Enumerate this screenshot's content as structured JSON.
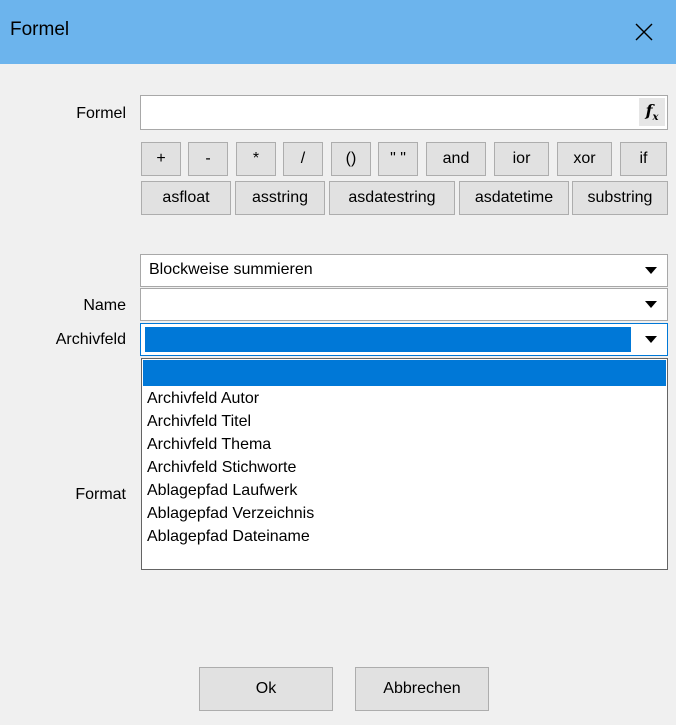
{
  "window": {
    "title": "Formel",
    "close_icon": "close-icon"
  },
  "formula": {
    "label": "Formel",
    "value": "",
    "fx_label": "fx"
  },
  "operators_row1": [
    "+",
    "-",
    "*",
    "/",
    "()",
    "\" \"",
    "and",
    "ior",
    "xor",
    "if"
  ],
  "operators_row2": [
    "asfloat",
    "asstring",
    "asdatestring",
    "asdatetime",
    "substring"
  ],
  "mode_combo": {
    "value": "Blockweise summieren"
  },
  "name": {
    "label": "Name",
    "value": ""
  },
  "archivfeld": {
    "label": "Archivfeld",
    "value": "",
    "options": [
      "",
      "Archivfeld Autor",
      "Archivfeld Titel",
      "Archivfeld Thema",
      "Archivfeld Stichworte",
      "Ablagepfad Laufwerk",
      "Ablagepfad Verzeichnis",
      "Ablagepfad Dateiname"
    ]
  },
  "format": {
    "label": "Format"
  },
  "buttons": {
    "ok": "Ok",
    "cancel": "Abbrechen"
  },
  "colors": {
    "titlebar": "#6cb4ed",
    "selection": "#0078d7",
    "background": "#f0f0f0"
  }
}
